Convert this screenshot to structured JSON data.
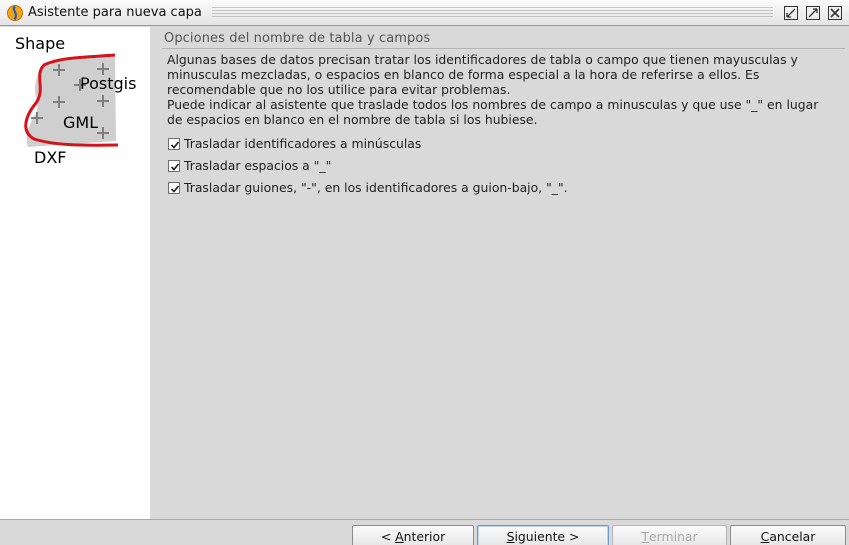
{
  "window": {
    "title": "Asistente para nueva capa",
    "icons": [
      "app-icon",
      "restore-icon",
      "maximize-icon",
      "close-icon"
    ]
  },
  "left_panel": {
    "logo_labels": {
      "shape": "Shape",
      "postgis": "Postgis",
      "gml": "GML",
      "dxf": "DXF"
    }
  },
  "main": {
    "section_title": "Opciones del nombre de tabla y campos",
    "description_lines": [
      "Algunas bases de datos precisan tratar los identificadores de tabla o campo que tienen mayusculas y",
      "minusculas mezcladas, o espacios en blanco de forma especial a la hora de referirse a ellos. Es",
      "recomendable que no los utilice para evitar problemas.",
      "Puede indicar al asistente que traslade todos los nombres de campo a minusculas y que use \"_\" en lugar",
      "de espacios en blanco en el nombre de tabla si los hubiese."
    ],
    "options": [
      {
        "label": "Trasladar identificadores a minúsculas",
        "checked": true
      },
      {
        "label": "Trasladar espacios a \"_\"",
        "checked": true
      },
      {
        "label": "Trasladar guiones, \"-\", en los identificadores a guion-bajo, \"_\".",
        "checked": true
      }
    ]
  },
  "buttons": {
    "previous": {
      "prefix": "< ",
      "mnemonic": "A",
      "rest": "nterior"
    },
    "next": {
      "mnemonic": "S",
      "rest": "iguiente",
      "suffix": " >"
    },
    "finish": {
      "mnemonic": "T",
      "rest": "erminar",
      "enabled": false
    },
    "cancel": {
      "mnemonic": "C",
      "rest": "ancelar"
    }
  },
  "colors": {
    "logo_red": "#d4141b",
    "logo_grey": "#cfcfcf",
    "focus_blue": "#6b9bc8"
  }
}
